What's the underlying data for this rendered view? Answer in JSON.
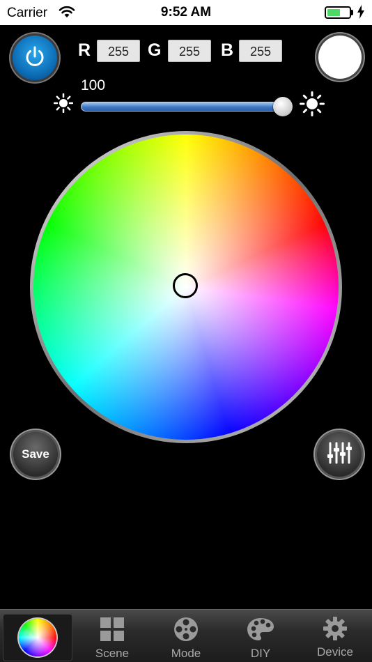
{
  "status_bar": {
    "carrier": "Carrier",
    "time": "9:52 AM",
    "battery_level": 0.6,
    "wifi_icon": "wifi-icon",
    "charging_icon": "bolt-icon"
  },
  "controls": {
    "power_icon": "power-icon",
    "r_label": "R",
    "r_value": "255",
    "g_label": "G",
    "g_value": "255",
    "b_label": "B",
    "b_value": "255",
    "preview_color": "#ffffff"
  },
  "brightness": {
    "value": "100",
    "level": 1.0,
    "min_icon": "sun-small-icon",
    "max_icon": "sun-large-icon"
  },
  "wheel": {
    "selected_color": "#ffffff"
  },
  "actions": {
    "save_label": "Save",
    "adjust_icon": "sliders-icon"
  },
  "tabs": [
    {
      "label": "",
      "icon": "color-wheel-icon",
      "active": true
    },
    {
      "label": "Scene",
      "icon": "grid-icon",
      "active": false
    },
    {
      "label": "Mode",
      "icon": "film-reel-icon",
      "active": false
    },
    {
      "label": "DIY",
      "icon": "palette-icon",
      "active": false
    },
    {
      "label": "Device",
      "icon": "gear-icon",
      "active": false
    }
  ],
  "colors": {
    "accent_blue": "#0d6fb8",
    "battery_green": "#4cd964",
    "tab_label": "#a8a8a8"
  }
}
